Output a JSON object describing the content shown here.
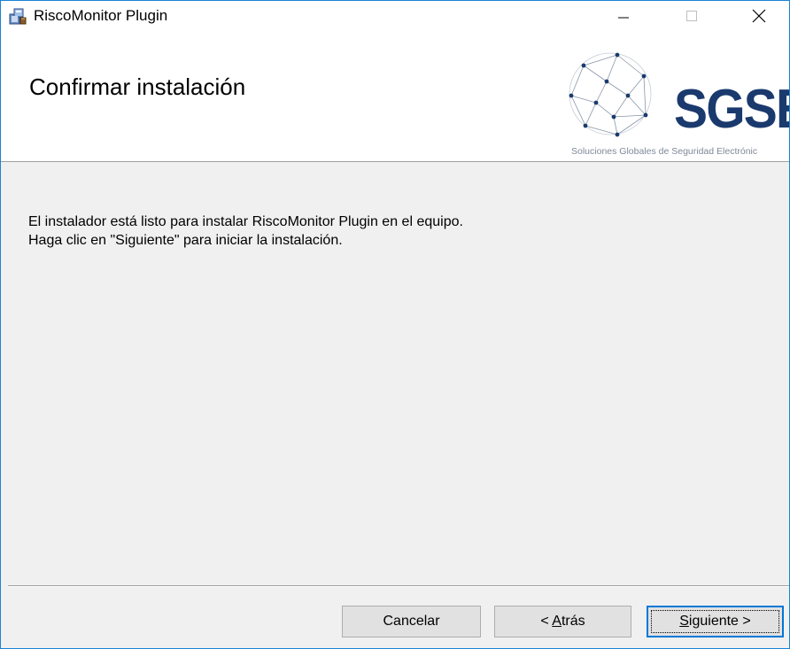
{
  "window": {
    "title": "RiscoMonitor Plugin",
    "accent_color": "#1883d7",
    "icon": "installer-package-icon"
  },
  "titlebar_buttons": {
    "minimize_icon": "minimize-icon",
    "maximize_icon": "maximize-icon",
    "close_icon": "close-icon"
  },
  "banner": {
    "heading": "Confirmar instalación",
    "logo": {
      "wordmark": "SGSE",
      "tagline": "Soluciones Globales de Seguridad Electrónic",
      "icon": "globe-network-icon",
      "brand_color": "#1a3a6e"
    }
  },
  "body": {
    "line1": "El instalador está listo para instalar RiscoMonitor Plugin en el equipo.",
    "line2": "Haga clic en \"Siguiente\" para iniciar la instalación."
  },
  "buttons": {
    "cancel": "Cancelar",
    "back_prefix": "< ",
    "back_mnemonic": "A",
    "back_rest": "trás",
    "next_mnemonic": "S",
    "next_rest": "iguiente >"
  }
}
